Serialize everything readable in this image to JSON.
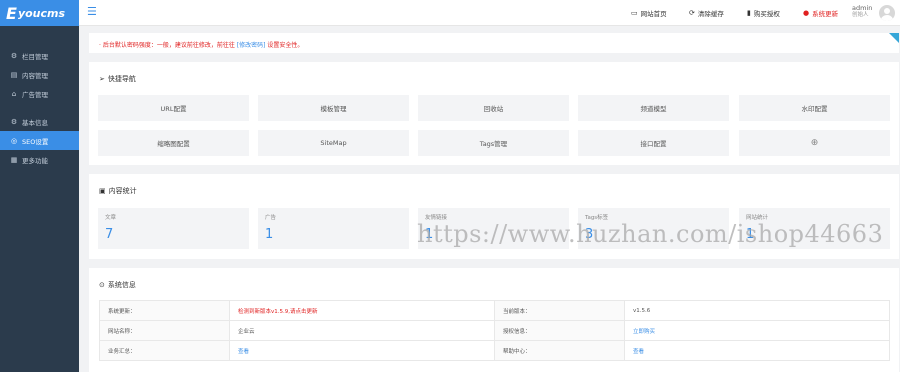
{
  "app": {
    "logo_initial": "E",
    "logo_rest": "youcms"
  },
  "sidebar": {
    "items": [
      {
        "icon": "⚙",
        "label": "栏目管理"
      },
      {
        "icon": "▤",
        "label": "内容管理"
      },
      {
        "icon": "⌂",
        "label": "广告管理"
      },
      {
        "icon": "⚙",
        "label": "基本信息"
      },
      {
        "icon": "◎",
        "label": "SEO设置"
      },
      {
        "icon": "▦",
        "label": "更多功能"
      }
    ]
  },
  "header": {
    "links": [
      {
        "icon": "▭",
        "label": "网站首页"
      },
      {
        "icon": "⟳",
        "label": "清除缓存"
      },
      {
        "icon": "▮",
        "label": "购买授权"
      },
      {
        "icon": "●",
        "label": "系统更新"
      }
    ],
    "user": {
      "name": "admin",
      "role": "创始人"
    }
  },
  "notice": {
    "prefix": "· 后台默认密码强度：一般，建议前往修改，前往往",
    "link": "[修改密码]",
    "suffix": "设置安全性。"
  },
  "quick_nav": {
    "title": "快捷导航",
    "buttons": [
      "URL配置",
      "模板管理",
      "回收站",
      "频道模型",
      "水印配置",
      "缩略图配置",
      "SiteMap",
      "Tags管理",
      "接口配置",
      "⊕"
    ]
  },
  "stats": {
    "title": "内容统计",
    "items": [
      {
        "label": "文章",
        "value": "7"
      },
      {
        "label": "广告",
        "value": "1"
      },
      {
        "label": "友情链接",
        "value": "1"
      },
      {
        "label": "Tags标签",
        "value": "3"
      },
      {
        "label": "网站统计",
        "value": "1"
      }
    ]
  },
  "sysinfo": {
    "title": "系统信息",
    "rows": [
      {
        "k1": "系统更新：",
        "v1": "检测到新版本v1.5.9,请点击更新",
        "k2": "当前版本：",
        "v2": "v1.5.6"
      },
      {
        "k1": "网站名称：",
        "v1": "企业云",
        "k2": "授权信息：",
        "v2": "立即购买"
      },
      {
        "k1": "业务汇总：",
        "v1": "查看",
        "k2": "帮助中心：",
        "v2": "查看"
      }
    ]
  },
  "watermark": "https://www.huzhan.com/ishop44663",
  "colors": {
    "accent": "#3a8ee6",
    "sidebar_bg": "#2b3b4c",
    "danger": "#e02020"
  }
}
